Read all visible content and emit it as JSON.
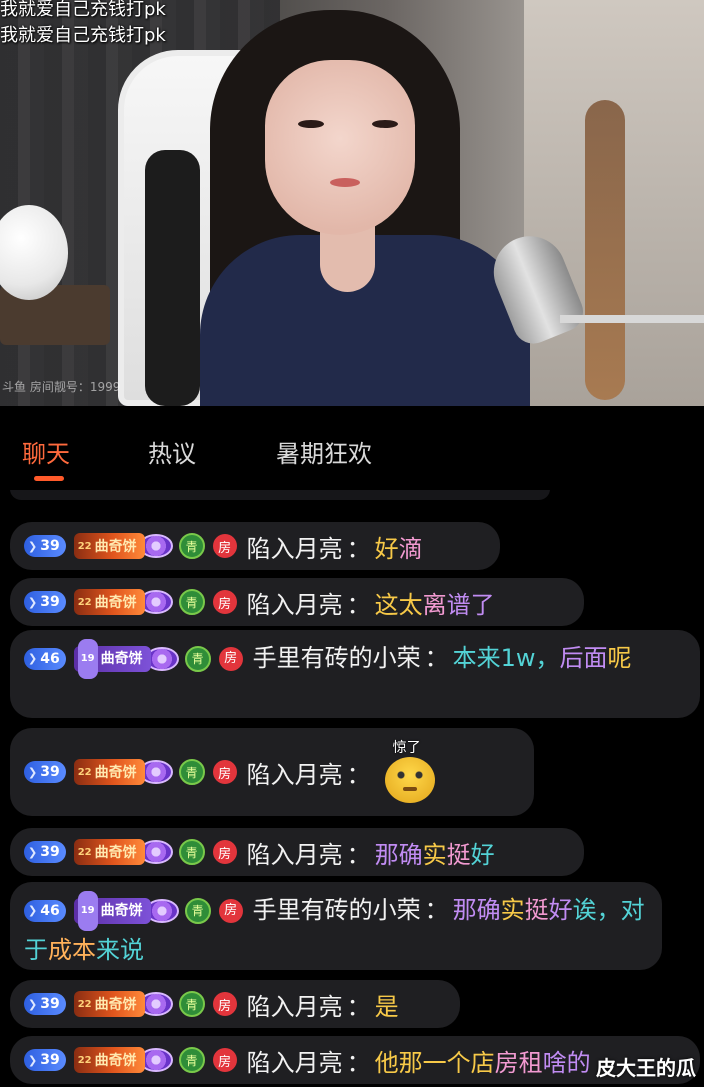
{
  "video": {
    "overlay_lines": [
      "我就爱自己充钱打pk",
      "我就爱自己充钱打pk"
    ],
    "room_watermark": "斗鱼 房间靓号：1999"
  },
  "tabs": [
    {
      "label": "聊天",
      "active": true
    },
    {
      "label": "热议",
      "active": false
    },
    {
      "label": "暑期狂欢",
      "active": false
    }
  ],
  "chat": {
    "messages": [
      {
        "level": "39",
        "fan_badge": "曲奇饼",
        "fan_level": "22",
        "noble": "青",
        "room": "房",
        "user": "陷入月亮",
        "sep": "：",
        "segments": [
          {
            "t": "好",
            "c": "yellow"
          },
          {
            "t": "滴",
            "c": "pink"
          }
        ]
      },
      {
        "level": "39",
        "fan_badge": "曲奇饼",
        "fan_level": "22",
        "noble": "青",
        "room": "房",
        "user": "陷入月亮",
        "sep": "：",
        "segments": [
          {
            "t": "这太",
            "c": "yellow"
          },
          {
            "t": "离",
            "c": "pink"
          },
          {
            "t": "谱了",
            "c": "violet"
          }
        ]
      },
      {
        "level": "46",
        "fan_badge": "曲奇饼",
        "fan_level": "19",
        "noble": "青",
        "room": "房",
        "user": "手里有砖的小荣",
        "sep": "：",
        "segments": [
          {
            "t": "本来1w，",
            "c": "cyan"
          },
          {
            "t": "后面",
            "c": "violet"
          },
          {
            "t": "呢",
            "c": "yellow"
          }
        ]
      },
      {
        "level": "39",
        "fan_badge": "曲奇饼",
        "fan_level": "22",
        "noble": "青",
        "room": "房",
        "user": "陷入月亮",
        "sep": "：",
        "emoji_caption": "惊了"
      },
      {
        "level": "39",
        "fan_badge": "曲奇饼",
        "fan_level": "22",
        "noble": "青",
        "room": "房",
        "user": "陷入月亮",
        "sep": "：",
        "segments": [
          {
            "t": "那确",
            "c": "violet"
          },
          {
            "t": "实",
            "c": "yellow"
          },
          {
            "t": "挺",
            "c": "pink"
          },
          {
            "t": "好",
            "c": "cyan"
          }
        ]
      },
      {
        "level": "46",
        "fan_badge": "曲奇饼",
        "fan_level": "19",
        "noble": "青",
        "room": "房",
        "user": "手里有砖的小荣",
        "sep": "：",
        "segments": [
          {
            "t": "那确",
            "c": "violet"
          },
          {
            "t": "实",
            "c": "yellow"
          },
          {
            "t": "挺",
            "c": "pink"
          },
          {
            "t": "好",
            "c": "violet"
          },
          {
            "t": "诶，对于",
            "c": "cyan"
          },
          {
            "t": "成本",
            "c": "orange"
          },
          {
            "t": "来说",
            "c": "cyan"
          }
        ]
      },
      {
        "level": "39",
        "fan_badge": "曲奇饼",
        "fan_level": "22",
        "noble": "青",
        "room": "房",
        "user": "陷入月亮",
        "sep": "：",
        "segments": [
          {
            "t": "是",
            "c": "yellow"
          }
        ]
      },
      {
        "level": "39",
        "fan_badge": "曲奇饼",
        "fan_level": "22",
        "noble": "青",
        "room": "房",
        "user": "陷入月亮",
        "sep": "：",
        "segments": [
          {
            "t": "他那一个店",
            "c": "yellow"
          },
          {
            "t": "房租",
            "c": "pink"
          },
          {
            "t": "啥的",
            "c": "violet"
          }
        ]
      }
    ]
  },
  "watermark": "皮大王的瓜",
  "colors": {
    "accent": "#ff6a3d",
    "bubble": "#1f1f22",
    "level_badge": "#3d6cf0"
  }
}
